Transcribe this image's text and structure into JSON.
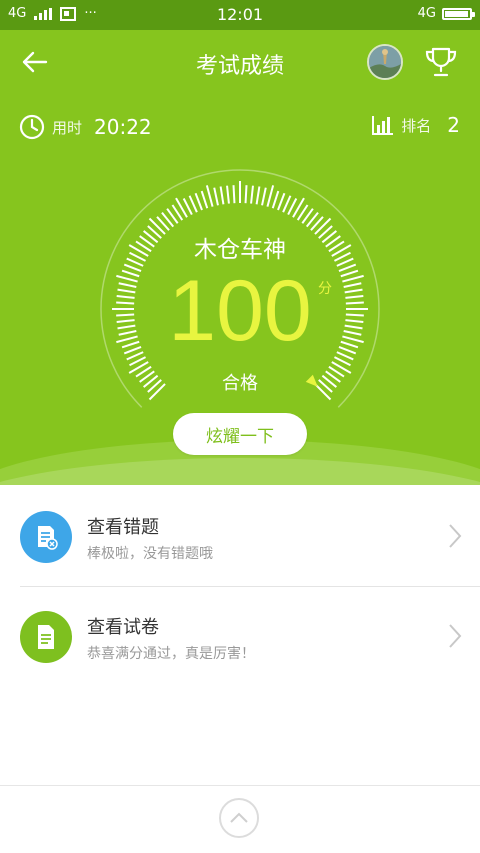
{
  "status_bar": {
    "left_network": "4G",
    "time": "12:01",
    "right_network": "4G",
    "battery_level": 0.95
  },
  "header": {
    "title": "考试成绩"
  },
  "stats": {
    "time_label": "用时",
    "time_value": "20:22",
    "rank_label": "排名",
    "rank_value": "2"
  },
  "result": {
    "name": "木仓车神",
    "score": "100",
    "unit": "分",
    "grade": "合格",
    "gauge_fraction": 1.0,
    "share_label": "炫耀一下"
  },
  "list": [
    {
      "title": "查看错题",
      "subtitle": "棒极啦，没有错题哦",
      "icon": "wrong-questions-icon",
      "color": "#3ea6e8"
    },
    {
      "title": "查看试卷",
      "subtitle": "恭喜满分通过，真是厉害！",
      "icon": "exam-paper-icon",
      "color": "#7ec01f"
    }
  ],
  "colors": {
    "primary_green": "#86c51e",
    "score_yellow": "#e8f540",
    "blue": "#3ea6e8"
  }
}
